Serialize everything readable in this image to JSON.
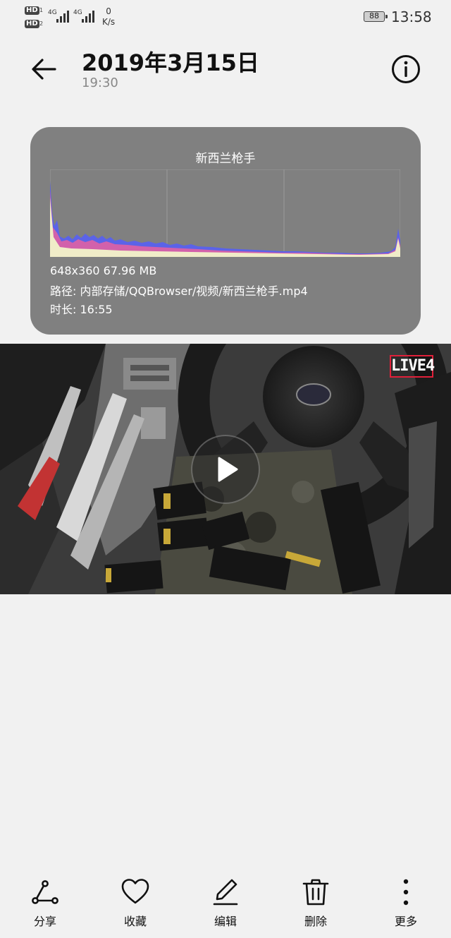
{
  "status_bar": {
    "sim1": "HD",
    "sim2": "HD",
    "sim1_num": "1",
    "sim2_num": "2",
    "network1": "4G",
    "network2": "4G",
    "speed_value": "0",
    "speed_unit": "K/s",
    "battery": "88",
    "time": "13:58"
  },
  "header": {
    "title": "2019年3月15日",
    "subtitle": "19:30"
  },
  "info_card": {
    "name": "新西兰枪手",
    "resolution_size": "648x360  67.96 MB",
    "path": "路径:  内部存储/QQBrowser/视频/新西兰枪手.mp4",
    "duration": "时长:  16:55"
  },
  "video": {
    "live_badge": "LIVE4"
  },
  "toolbar": {
    "share": "分享",
    "favorite": "收藏",
    "edit": "编辑",
    "delete": "删除",
    "more": "更多"
  },
  "icons": {
    "back": "arrow-left-icon",
    "info": "info-icon",
    "play": "play-icon",
    "share": "share-icon",
    "favorite": "heart-icon",
    "edit": "pencil-icon",
    "delete": "trash-icon",
    "more": "more-vertical-icon"
  },
  "colors": {
    "card_bg": "#808080",
    "histogram_blue": "#5b63e8",
    "histogram_pink": "#e860a0",
    "histogram_yellow": "#e8e0a0",
    "live_border": "#e0203a"
  }
}
